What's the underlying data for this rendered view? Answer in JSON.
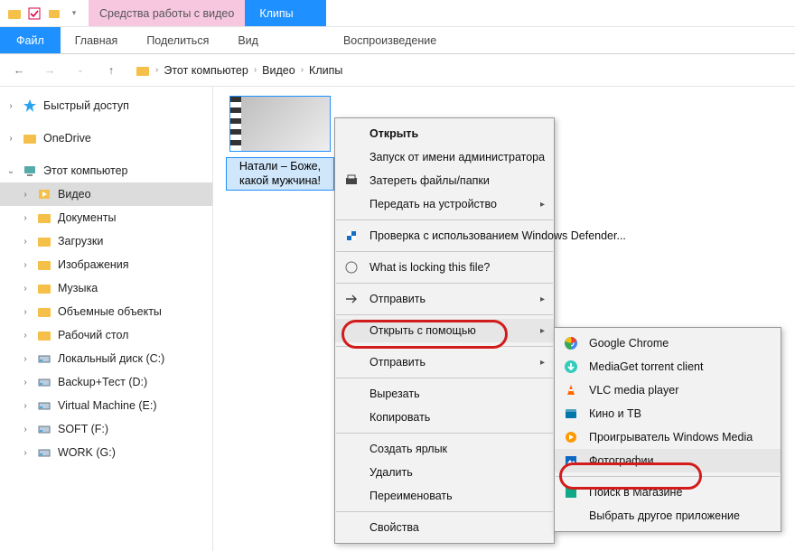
{
  "window": {
    "title": "Клипы"
  },
  "contextual_tab": "Средства работы с видео",
  "ribbon": {
    "file": "Файл",
    "tabs": [
      "Главная",
      "Поделиться",
      "Вид"
    ],
    "contextual": "Воспроизведение"
  },
  "breadcrumbs": [
    "Этот компьютер",
    "Видео",
    "Клипы"
  ],
  "tree": {
    "quick_access": "Быстрый доступ",
    "onedrive": "OneDrive",
    "this_pc": "Этот компьютер",
    "children": [
      {
        "label": "Видео",
        "selected": true
      },
      {
        "label": "Документы"
      },
      {
        "label": "Загрузки"
      },
      {
        "label": "Изображения"
      },
      {
        "label": "Музыка"
      },
      {
        "label": "Объемные объекты"
      },
      {
        "label": "Рабочий стол"
      },
      {
        "label": "Локальный диск (C:)"
      },
      {
        "label": "Backup+Тест (D:)"
      },
      {
        "label": "Virtual Machine (E:)"
      },
      {
        "label": "SOFT (F:)"
      },
      {
        "label": "WORK (G:)"
      }
    ]
  },
  "file": {
    "name": "Натали – Боже, какой мужчина!"
  },
  "context_menu": {
    "open": "Открыть",
    "run_admin": "Запуск от имени администратора",
    "shred": "Затереть файлы/папки",
    "cast": "Передать на устройство",
    "defender": "Проверка с использованием Windows Defender...",
    "whatlock": "What is locking this file?",
    "sendto1": "Отправить",
    "open_with": "Открыть с помощью",
    "sendto2": "Отправить",
    "cut": "Вырезать",
    "copy": "Копировать",
    "shortcut": "Создать ярлык",
    "delete": "Удалить",
    "rename": "Переименовать",
    "properties": "Свойства"
  },
  "open_with_menu": {
    "items": [
      {
        "label": "Google Chrome",
        "icon": "chrome"
      },
      {
        "label": "MediaGet torrent client",
        "icon": "mediaget"
      },
      {
        "label": "VLC media player",
        "icon": "vlc"
      },
      {
        "label": "Кино и ТВ",
        "icon": "movies-tv"
      },
      {
        "label": "Проигрыватель Windows Media",
        "icon": "wmp"
      },
      {
        "label": "Фотографии",
        "icon": "photos",
        "highlighted": true
      }
    ],
    "store": "Поиск в Магазине",
    "other": "Выбрать другое приложение"
  }
}
